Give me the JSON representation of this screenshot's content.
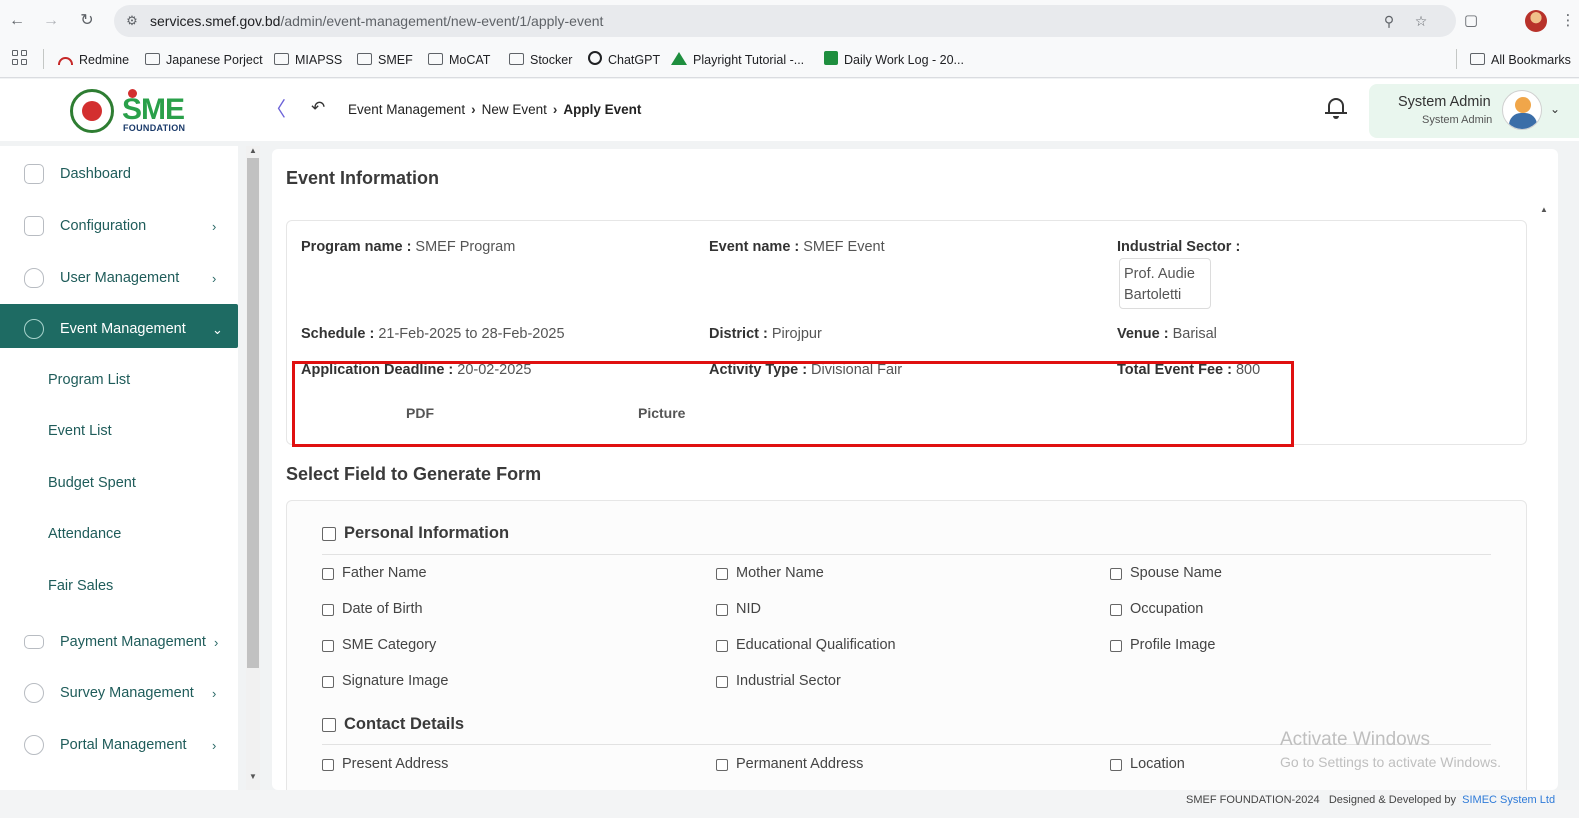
{
  "browser": {
    "url_host": "services.smef.gov.bd",
    "url_path": "/admin/event-management/new-event/1/apply-event",
    "bookmarks": [
      {
        "label": "Redmine"
      },
      {
        "label": "Japanese Porject"
      },
      {
        "label": "MIAPSS"
      },
      {
        "label": "SMEF"
      },
      {
        "label": "MoCAT"
      },
      {
        "label": "Stocker"
      },
      {
        "label": "ChatGPT"
      },
      {
        "label": "Playright Tutorial -..."
      },
      {
        "label": "Daily Work Log - 20..."
      }
    ],
    "all_bookmarks": "All Bookmarks"
  },
  "header": {
    "logo_sme": "SME",
    "logo_foundation": "FOUNDATION",
    "breadcrumb": [
      "Event Management",
      "New Event",
      "Apply Event"
    ],
    "user_name": "System Admin",
    "user_role": "System Admin"
  },
  "sidebar": {
    "items": [
      {
        "label": "Dashboard"
      },
      {
        "label": "Configuration"
      },
      {
        "label": "User Management"
      },
      {
        "label": "Event Management"
      },
      {
        "label": "Payment Management"
      },
      {
        "label": "Survey Management"
      },
      {
        "label": "Portal Management"
      }
    ],
    "sub_items": [
      {
        "label": "Program List"
      },
      {
        "label": "Event List"
      },
      {
        "label": "Budget Spent"
      },
      {
        "label": "Attendance"
      },
      {
        "label": "Fair Sales"
      }
    ]
  },
  "event_info": {
    "title": "Event Information",
    "program_name_label": "Program name :",
    "program_name": "SMEF Program",
    "event_name_label": "Event name :",
    "event_name": "SMEF Event",
    "industrial_sector_label": "Industrial Sector :",
    "industrial_sector": "Prof. Audie Bartoletti",
    "schedule_label": "Schedule :",
    "schedule": "21-Feb-2025 to 28-Feb-2025",
    "district_label": "District :",
    "district": "Pirojpur",
    "venue_label": "Venue :",
    "venue": "Barisal",
    "deadline_label": "Application Deadline :",
    "deadline": "20-02-2025",
    "activity_type_label": "Activity Type :",
    "activity_type": "Divisional Fair",
    "total_fee_label": "Total Event Fee :",
    "total_fee": "800",
    "pdf_label": "PDF",
    "picture_label": "Picture"
  },
  "form_fields": {
    "title": "Select Field to Generate Form",
    "groups": [
      {
        "label": "Personal Information",
        "options": [
          "Father Name",
          "Mother Name",
          "Spouse Name",
          "Date of Birth",
          "NID",
          "Occupation",
          "SME Category",
          "Educational Qualification",
          "Profile Image",
          "Signature Image",
          "Industrial Sector"
        ]
      },
      {
        "label": "Contact Details",
        "options": [
          "Present Address",
          "Permanent Address",
          "Location"
        ]
      }
    ]
  },
  "watermark": {
    "line1": "Activate Windows",
    "line2": "Go to Settings to activate Windows."
  },
  "footer": {
    "copyright": "SMEF FOUNDATION-2024",
    "designed_by": "Designed & Developed by",
    "company": "SIMEC System Ltd"
  },
  "colors": {
    "sidebar_active": "#1e6b63",
    "highlight_border": "#e01010",
    "user_card_bg": "#e9f6ee"
  }
}
